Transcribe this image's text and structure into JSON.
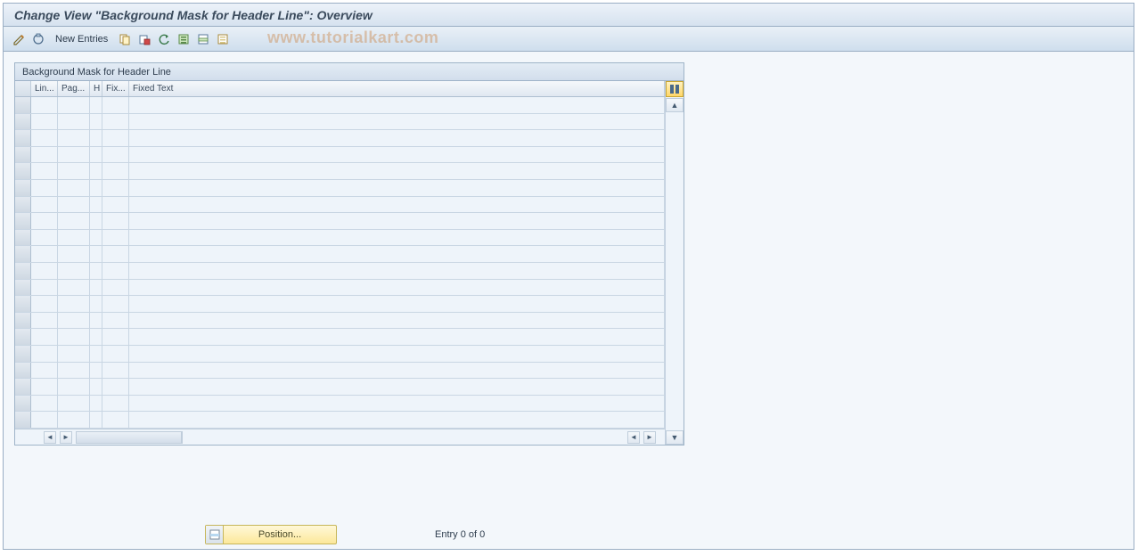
{
  "title": "Change View \"Background Mask for Header Line\": Overview",
  "toolbar": {
    "new_entries_label": "New Entries"
  },
  "watermark": "www.tutorialkart.com",
  "group": {
    "title": "Background Mask for Header Line",
    "columns": {
      "lin": "Lin...",
      "pag": "Pag...",
      "h": "H",
      "fix": "Fix...",
      "fixed_text": "Fixed Text"
    },
    "visible_row_count": 20
  },
  "footer": {
    "position_label": "Position...",
    "entry_text": "Entry 0 of 0"
  }
}
